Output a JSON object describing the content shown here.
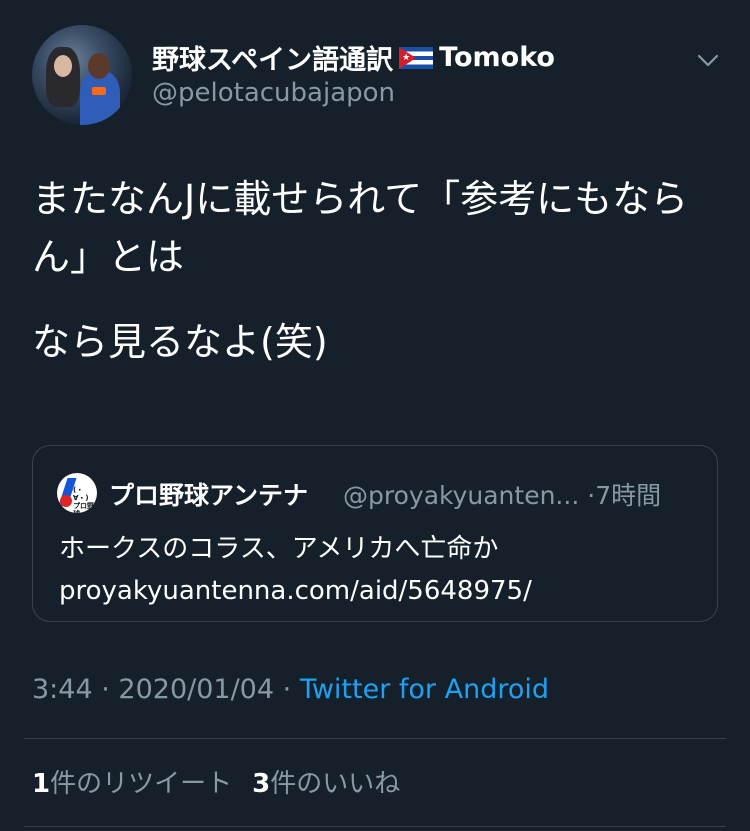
{
  "tweet": {
    "author": {
      "display_name": "野球スペイン語通訳",
      "flag_icon": "cuba-flag-icon",
      "display_name_suffix": "Tomoko",
      "handle": "@pelotacubajapon"
    },
    "text_line_1": "またなんJに載せられて「参考にもならん」とは",
    "text_line_2": "なら見るなよ(笑)",
    "quoted": {
      "display_name": "プロ野球アンテナ",
      "handle": "@proyakyuanten...",
      "separator": "·",
      "time": "7時間",
      "text": "ホークスのコラス、アメリカへ亡命か",
      "link": "proyakyuantenna.com/aid/5648975/"
    },
    "meta": {
      "time": "3:44",
      "date": "2020/01/04",
      "separator": "·",
      "source": "Twitter for Android"
    },
    "stats": {
      "retweets_count": "1",
      "retweets_label": "件のリツイート",
      "likes_count": "3",
      "likes_label": "件のいいね"
    }
  },
  "colors": {
    "background": "#15202b",
    "secondary_text": "#8899a6",
    "link": "#1da1f2",
    "border": "#38444d"
  }
}
